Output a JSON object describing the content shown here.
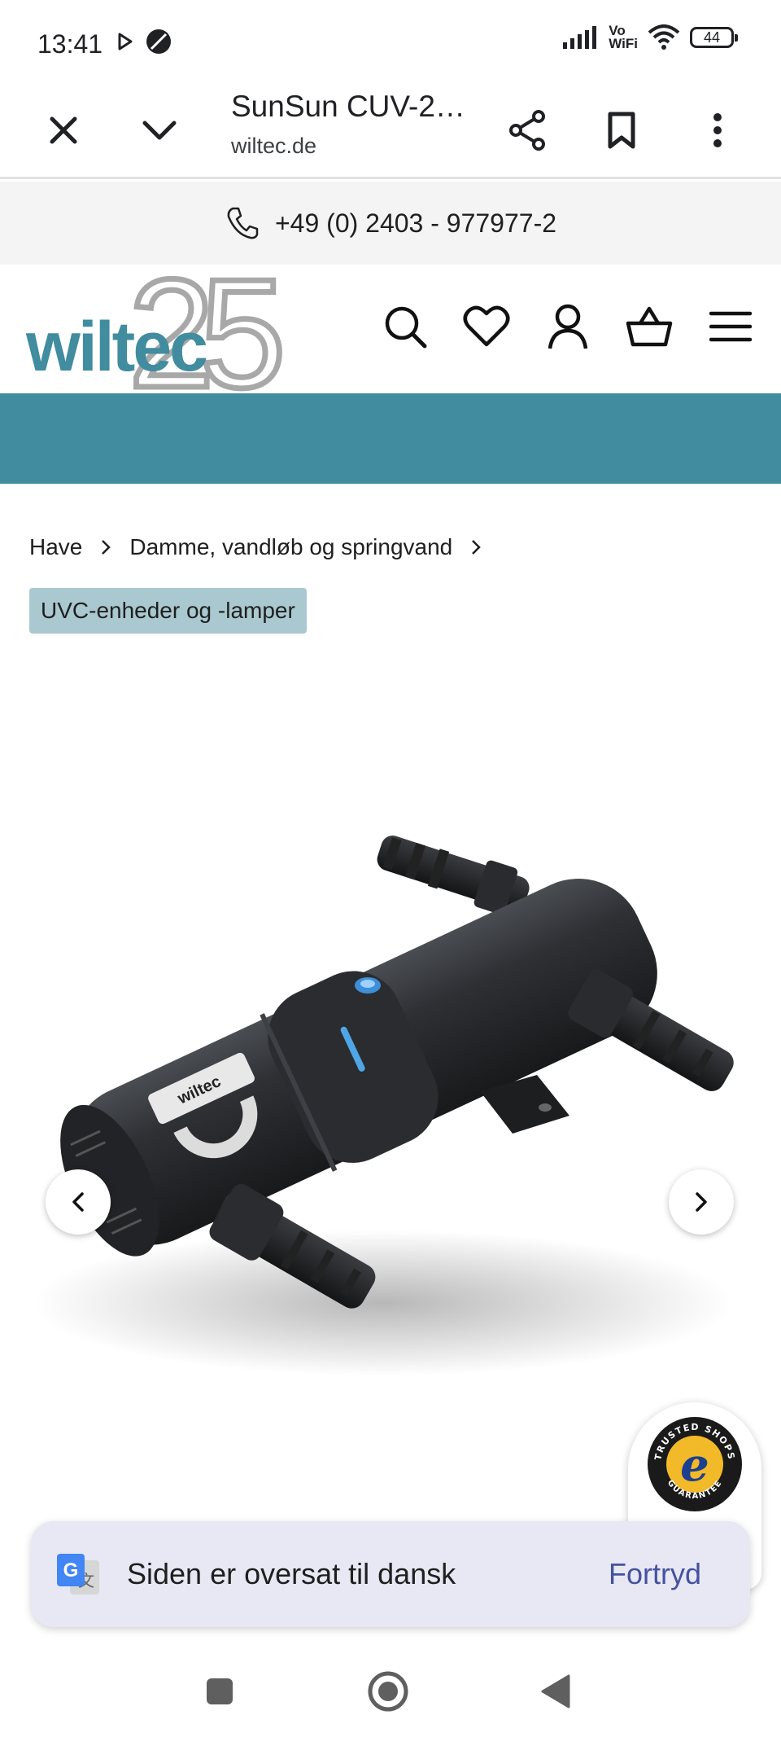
{
  "status_bar": {
    "time": "13:41",
    "network_label": "Vo\nWiFi",
    "battery_level": "44",
    "icons": [
      "play-icon",
      "data-saver-icon",
      "signal-icon",
      "vowifi-icon",
      "wifi-icon",
      "battery-icon"
    ]
  },
  "browser_toolbar": {
    "title": "SunSun CUV-2…",
    "url": "wiltec.de",
    "icons": [
      "close-icon",
      "chevron-down-icon",
      "share-icon",
      "bookmark-icon",
      "more-vert-icon"
    ]
  },
  "contact": {
    "phone": "+49 (0) 2403 - 977977-2"
  },
  "site_header": {
    "logo_text": "wiltec",
    "logo_anniversary": "25",
    "icons": [
      "search-icon",
      "heart-icon",
      "account-icon",
      "basket-icon",
      "menu-icon"
    ],
    "brand_color": "#418c9f"
  },
  "breadcrumb": {
    "items": [
      "Have",
      "Damme, vandløb og springvand"
    ],
    "category_chip": "UVC-enheder og -lamper"
  },
  "product_image": {
    "alt": "SunSun CUV-2 UVC-enhed",
    "device_label": "wiltec"
  },
  "trusted_shops": {
    "top_text": "TRUSTED SHOPS",
    "bottom_text": "GUARANTEE",
    "mark": "e"
  },
  "translate_bar": {
    "message": "Siden er oversat til dansk",
    "undo_label": "Fortryd"
  }
}
